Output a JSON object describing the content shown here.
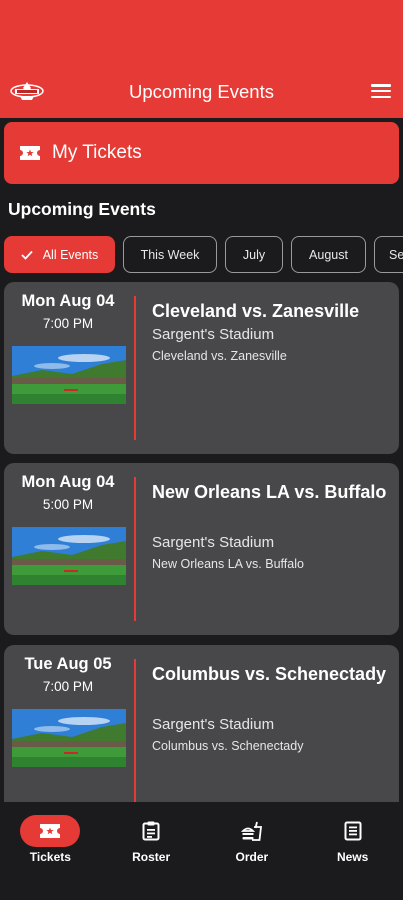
{
  "header": {
    "title": "Upcoming Events",
    "logo_icon": "team-logo-icon",
    "menu_icon": "hamburger-menu-icon",
    "accent_color": "#e53a35"
  },
  "my_tickets": {
    "label": "My Tickets",
    "icon": "ticket-icon"
  },
  "section_title": "Upcoming Events",
  "filters": [
    {
      "label": "All Events",
      "active": true
    },
    {
      "label": "This Week",
      "active": false
    },
    {
      "label": "July",
      "active": false
    },
    {
      "label": "August",
      "active": false
    },
    {
      "label": "Se",
      "active": false
    }
  ],
  "events": [
    {
      "date": "Mon Aug 04",
      "time": "7:00 PM",
      "title": "Cleveland vs. Zanesville",
      "venue": "Sargent's Stadium",
      "subtitle": "Cleveland vs. Zanesville"
    },
    {
      "date": "Mon Aug 04",
      "time": "5:00 PM",
      "title": "New Orleans LA vs. Buffalo",
      "venue": "Sargent's Stadium",
      "subtitle": "New Orleans LA vs. Buffalo"
    },
    {
      "date": "Tue Aug 05",
      "time": "7:00 PM",
      "title": "Columbus vs. Schenectady",
      "venue": "Sargent's Stadium",
      "subtitle": "Columbus vs. Schenectady"
    }
  ],
  "bottom_nav": [
    {
      "label": "Tickets",
      "icon": "ticket-icon",
      "active": true
    },
    {
      "label": "Roster",
      "icon": "clipboard-icon",
      "active": false
    },
    {
      "label": "Order",
      "icon": "food-order-icon",
      "active": false
    },
    {
      "label": "News",
      "icon": "newspaper-icon",
      "active": false
    }
  ]
}
